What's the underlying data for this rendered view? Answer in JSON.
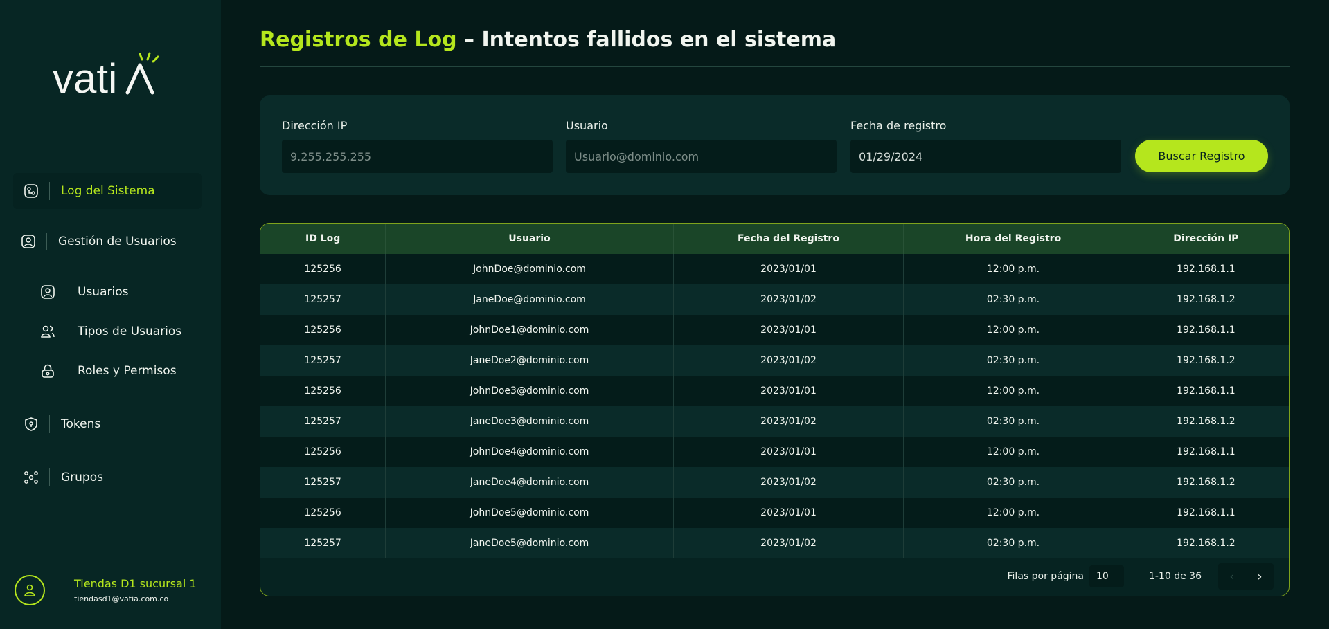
{
  "sidebar": {
    "logo_text": "vatiA",
    "nav": [
      {
        "label": "Log del Sistema",
        "icon": "log-icon"
      },
      {
        "label": "Gestión de Usuarios",
        "icon": "user-box-icon"
      },
      {
        "label": "Usuarios",
        "icon": "user-box-icon"
      },
      {
        "label": "Tipos de Usuarios",
        "icon": "users-group-icon"
      },
      {
        "label": "Roles y Permisos",
        "icon": "lock-icon"
      },
      {
        "label": "Tokens",
        "icon": "shield-icon"
      },
      {
        "label": "Grupos",
        "icon": "groups-icon"
      }
    ],
    "user": {
      "name": "Tiendas D1 sucursal 1",
      "email": "tiendasd1@vatia.com.co"
    }
  },
  "header": {
    "title_accent": "Registros de Log",
    "title_rest": " – Intentos fallidos en el sistema"
  },
  "filters": {
    "ip": {
      "label": "Dirección IP",
      "placeholder": "9.255.255.255"
    },
    "user": {
      "label": "Usuario",
      "placeholder": "Usuario@dominio.com"
    },
    "date": {
      "label": "Fecha de registro",
      "value": "01/29/2024"
    },
    "search_label": "Buscar Registro"
  },
  "table": {
    "columns": [
      "ID Log",
      "Usuario",
      "Fecha del Registro",
      "Hora del Registro",
      "Dirección IP"
    ],
    "rows": [
      [
        "125256",
        "JohnDoe@dominio.com",
        "2023/01/01",
        "12:00 p.m.",
        "192.168.1.1"
      ],
      [
        "125257",
        "JaneDoe@dominio.com",
        "2023/01/02",
        "02:30 p.m.",
        "192.168.1.2"
      ],
      [
        "125256",
        "JohnDoe1@dominio.com",
        "2023/01/01",
        "12:00 p.m.",
        "192.168.1.1"
      ],
      [
        "125257",
        "JaneDoe2@dominio.com",
        "2023/01/02",
        "02:30 p.m.",
        "192.168.1.2"
      ],
      [
        "125256",
        "JohnDoe3@dominio.com",
        "2023/01/01",
        "12:00 p.m.",
        "192.168.1.1"
      ],
      [
        "125257",
        "JaneDoe3@dominio.com",
        "2023/01/02",
        "02:30 p.m.",
        "192.168.1.2"
      ],
      [
        "125256",
        "JohnDoe4@dominio.com",
        "2023/01/01",
        "12:00 p.m.",
        "192.168.1.1"
      ],
      [
        "125257",
        "JaneDoe4@dominio.com",
        "2023/01/02",
        "02:30 p.m.",
        "192.168.1.2"
      ],
      [
        "125256",
        "JohnDoe5@dominio.com",
        "2023/01/01",
        "12:00 p.m.",
        "192.168.1.1"
      ],
      [
        "125257",
        "JaneDoe5@dominio.com",
        "2023/01/02",
        "02:30 p.m.",
        "192.168.1.2"
      ]
    ]
  },
  "pagination": {
    "rows_label": "Filas por página",
    "rows_value": "10",
    "range": "1-10 de 36",
    "prev_icon": "chevron-left-icon",
    "next_icon": "chevron-right-icon"
  },
  "colors": {
    "accent": "#b5e61d",
    "background": "#051a18",
    "sidebar": "#072624"
  }
}
